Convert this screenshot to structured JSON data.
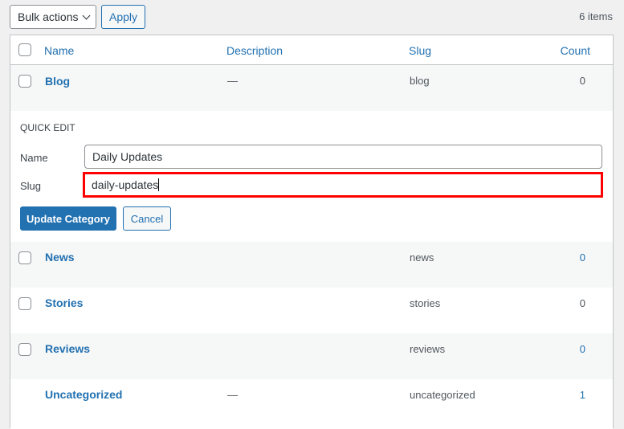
{
  "toolbar": {
    "bulk_actions": "Bulk actions",
    "apply": "Apply",
    "items_count": "6 items"
  },
  "table": {
    "headers": {
      "name": "Name",
      "description": "Description",
      "slug": "Slug",
      "count": "Count"
    },
    "rows": [
      {
        "name": "Blog",
        "description": "—",
        "slug": "blog",
        "count": "0"
      },
      {
        "name": "News",
        "description": "",
        "slug": "news",
        "count": "0"
      },
      {
        "name": "Stories",
        "description": "",
        "slug": "stories",
        "count": "0"
      },
      {
        "name": "Reviews",
        "description": "",
        "slug": "reviews",
        "count": "0"
      },
      {
        "name": "Uncategorized",
        "description": "—",
        "slug": "uncategorized",
        "count": "1"
      }
    ]
  },
  "quick_edit": {
    "title": "QUICK EDIT",
    "name_label": "Name",
    "name_value": "Daily Updates",
    "slug_label": "Slug",
    "slug_value": "daily-updates",
    "update": "Update Category",
    "cancel": "Cancel",
    "highlight_color": "#ff0000"
  }
}
